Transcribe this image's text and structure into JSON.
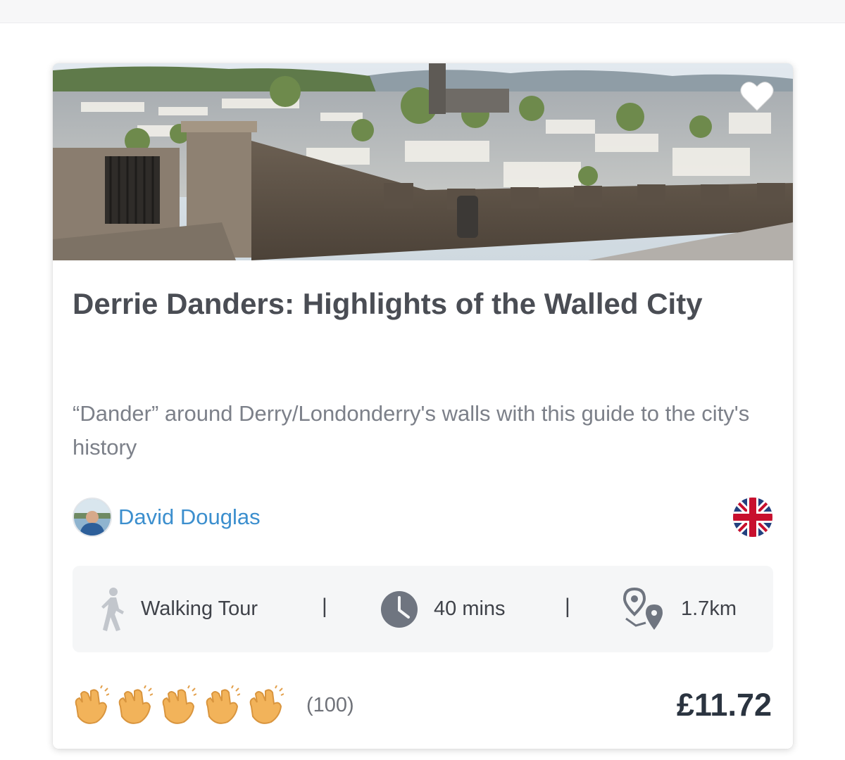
{
  "tour": {
    "title": "Derrie Danders: Highlights of the Walled City",
    "description": "“Dander” around Derry/Londonderry's walls with this guide to the city's history",
    "author": "David Douglas",
    "language_icon": "uk-flag-icon",
    "stats": {
      "type_label": "Walking Tour",
      "separator": "|",
      "duration": "40 mins",
      "distance": "1.7km"
    },
    "rating": {
      "icon": "clap-icon",
      "claps": 5,
      "count_label": "(100)"
    },
    "price": "£11.72"
  },
  "colors": {
    "author_link": "#3c8fce",
    "title": "#4a4d54",
    "clap": "#f2b35a",
    "price": "#2b3440"
  }
}
